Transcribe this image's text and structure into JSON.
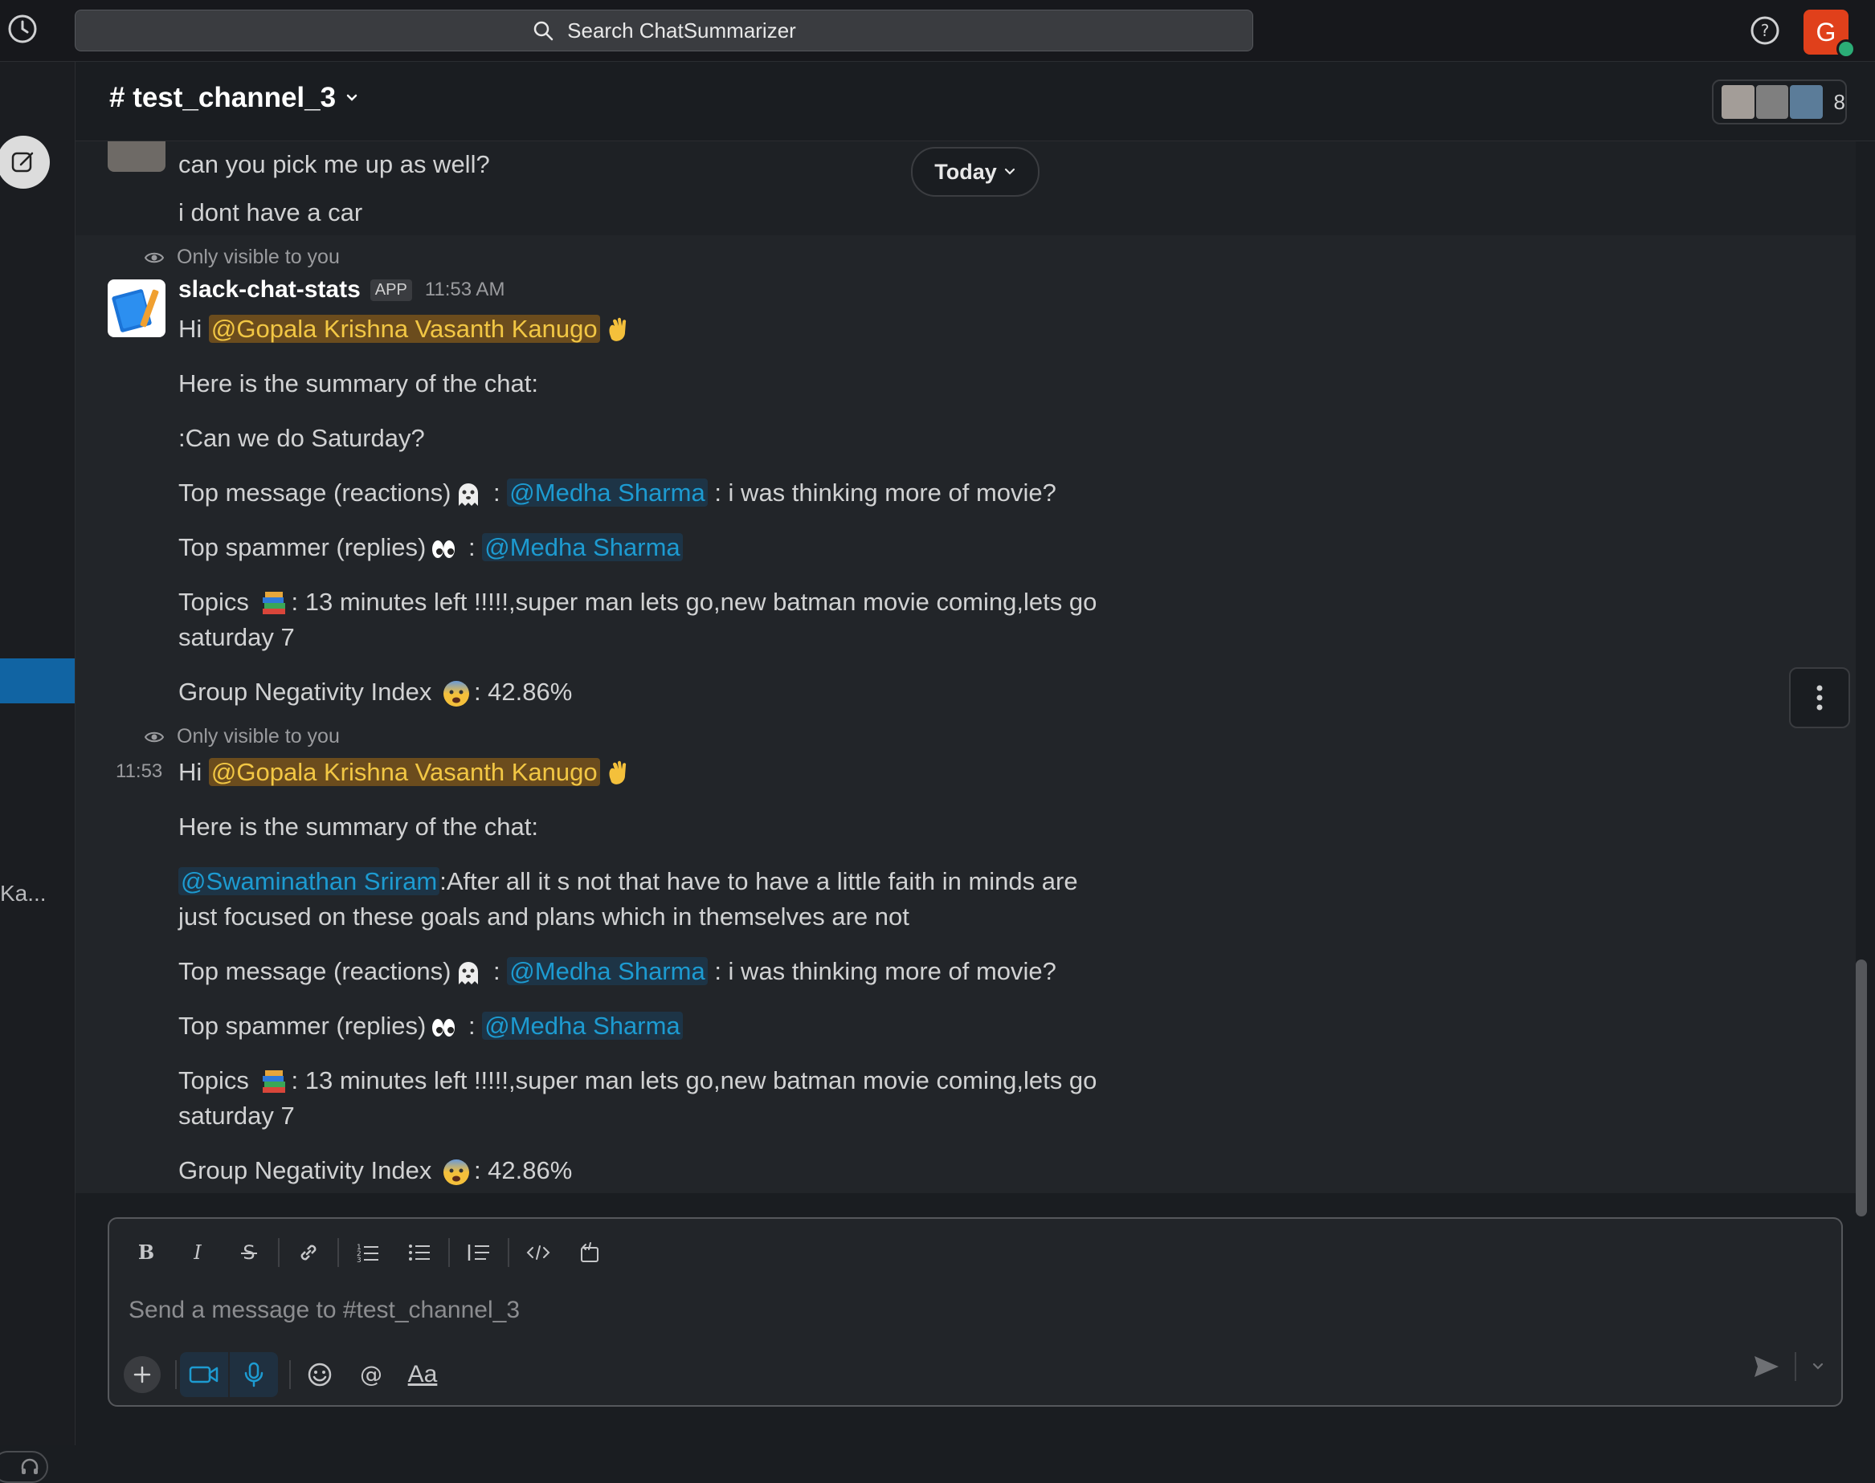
{
  "search": {
    "label": "Search ChatSummarizer"
  },
  "user": {
    "initial": "G",
    "status_color": "#2bac76",
    "avatar_color": "#e0401b"
  },
  "channel": {
    "name": "# test_channel_3",
    "members_count": "8"
  },
  "rail": {
    "truncated_label": "Ka..."
  },
  "date_divider": {
    "label": "Today"
  },
  "previous_messages": [
    {
      "text": "can you pick me up as well?"
    },
    {
      "text": "i dont have a car"
    }
  ],
  "visibility_note": "Only visible to you",
  "app_message": {
    "sender": "slack-chat-stats",
    "badge": "APP",
    "time": "11:53 AM",
    "hover_time": "11:53"
  },
  "summary_1": {
    "greeting": "Hi",
    "mention_self": "@Gopala Krishna Vasanth Kanugo",
    "intro": "Here is the summary of the chat:",
    "summary_line": ":Can we do Saturday?",
    "top_message_label": "Top message (reactions)",
    "top_message_mention": "@Medha Sharma",
    "top_message_text": ": i was thinking more of movie?",
    "top_spammer_label": "Top spammer (replies)",
    "top_spammer_mention": "@Medha Sharma",
    "topics_label": "Topics",
    "topics_text": ": 13 minutes left !!!!!,super man lets go,new batman movie coming,lets go saturday 7",
    "negativity_label": "Group Negativity Index",
    "negativity_value": ": 42.86%"
  },
  "summary_2": {
    "greeting": "Hi",
    "mention_self": "@Gopala Krishna Vasanth Kanugo",
    "intro": "Here is the summary of the chat:",
    "summary_mention": "@Swaminathan Sriram",
    "summary_text": ":After all it s not that have to have a little faith in minds are just focused on these goals and plans which in themselves are not",
    "top_message_label": "Top message (reactions)",
    "top_message_mention": "@Medha Sharma",
    "top_message_text": ": i was thinking more of movie?",
    "top_spammer_label": "Top spammer (replies)",
    "top_spammer_mention": "@Medha Sharma",
    "topics_label": "Topics",
    "topics_text": ": 13 minutes left !!!!!,super man lets go,new batman movie coming,lets go saturday 7",
    "negativity_label": "Group Negativity Index",
    "negativity_value": ": 42.86%"
  },
  "composer": {
    "placeholder": "Send a message to #test_channel_3",
    "format_label": "Aa"
  },
  "icons": [
    "history-icon",
    "search-icon",
    "help-icon",
    "compose-icon",
    "chevron-down-icon",
    "eye-icon",
    "waving-hand-icon",
    "ghost-icon",
    "eyes-icon",
    "books-icon",
    "fearful-face-icon",
    "more-vertical-icon",
    "bold-icon",
    "italic-icon",
    "strikethrough-icon",
    "link-icon",
    "ordered-list-icon",
    "bulleted-list-icon",
    "blockquote-icon",
    "code-icon",
    "code-block-icon",
    "plus-icon",
    "video-icon",
    "microphone-icon",
    "emoji-icon",
    "mention-icon",
    "send-icon",
    "headphones-icon"
  ]
}
